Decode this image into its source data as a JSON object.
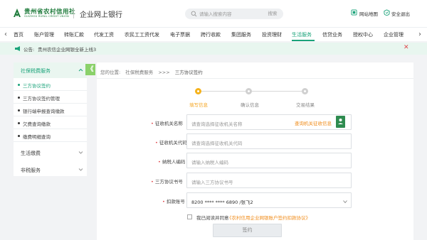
{
  "header": {
    "bank_name": "贵州省农村信用社",
    "bank_name_en": "GUIZHOU RURAL CREDIT UNION",
    "app_title": "企业网上银行",
    "search_placeholder": "请输入搜索内容",
    "search_button": "搜索",
    "site_map": "网站地图",
    "logout": "安全退出"
  },
  "nav": {
    "items": [
      "首页",
      "账户管理",
      "转账汇款",
      "代发工资",
      "农民工工资代发",
      "电子票据",
      "跨行收款",
      "集团服务",
      "投资理财",
      "生活服务",
      "信贷业务",
      "授权中心",
      "企业管理"
    ],
    "active_index": 9
  },
  "notice": {
    "label": "公告:",
    "text": "贵州农信企业网银全新上线3"
  },
  "sidebar": {
    "active_group": "社保税费服务",
    "sub_items": [
      "三方协议签约",
      "三方协议签约管理",
      "银行端申报查询缴款",
      "欠费查询缴款",
      "缴费明细查询"
    ],
    "active_sub_index": 0,
    "groups": [
      "生活缴费",
      "非税服务"
    ],
    "collapse_glyph": "《"
  },
  "breadcrumb": {
    "prefix": "您的位置:",
    "parent": "社保税费服务",
    "sep": ">>>",
    "current": "三方协议签约"
  },
  "steps": [
    {
      "label": "填写信息",
      "state": "active"
    },
    {
      "label": "确认信息",
      "state": "todo"
    },
    {
      "label": "交易结果",
      "state": "todo"
    }
  ],
  "form": {
    "org_name": {
      "label": "征收机关名称",
      "placeholder": "请查询选择征收机关名称",
      "link": "查询机关征收信息"
    },
    "org_code": {
      "label": "征收机关代码",
      "placeholder": "请查询选择征收机关代码"
    },
    "taxpayer_code": {
      "label": "纳税人编码",
      "placeholder": "请输入纳税人编码"
    },
    "agreement_no": {
      "label": "三方协议书号",
      "placeholder": "请输入三方协议书号"
    },
    "debit_account": {
      "label": "扣款账号",
      "value": "8200 **** **** 6890 /张飞2"
    },
    "agree_text": "我已阅读并同意",
    "agree_link": "《农村信用企业网银账户签约扣款协议》",
    "submit": "签约"
  },
  "colors": {
    "brand_green": "#1d7a3a",
    "accent_green": "#1aa37a",
    "warning_orange": "#f08c1a",
    "step_active": "#f5b21b",
    "close_red": "#e0474c"
  }
}
